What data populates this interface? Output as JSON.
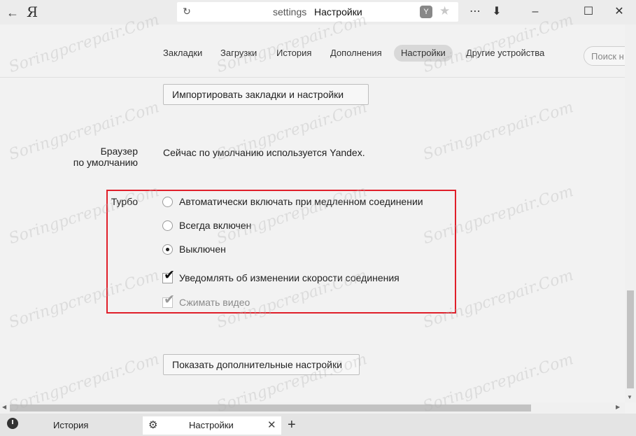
{
  "browser": {
    "logo": "Я",
    "address": {
      "host": "settings",
      "title": "Настройки"
    },
    "controls": {
      "menu": "⋯",
      "download": "⬇",
      "minimize": "–",
      "maximize": "☐",
      "close": "✕"
    }
  },
  "nav": {
    "items": [
      {
        "label": "Закладки"
      },
      {
        "label": "Загрузки"
      },
      {
        "label": "История"
      },
      {
        "label": "Дополнения"
      },
      {
        "label": "Настройки"
      },
      {
        "label": "Другие устройства"
      }
    ],
    "active": "Настройки",
    "search_placeholder": "Поиск н"
  },
  "import_button": "Импортировать закладки и настройки",
  "default_browser": {
    "label_line1": "Браузер",
    "label_line2": "по умолчанию",
    "text": "Сейчас по умолчанию используется Yandex."
  },
  "turbo": {
    "label": "Турбо",
    "options": [
      {
        "label": "Автоматически включать при медленном соединении",
        "type": "radio",
        "checked": false
      },
      {
        "label": "Всегда включен",
        "type": "radio",
        "checked": false
      },
      {
        "label": "Выключен",
        "type": "radio",
        "checked": true
      },
      {
        "label": "Уведомлять об изменении скорости соединения",
        "type": "checkbox",
        "checked": true
      },
      {
        "label": "Сжимать видео",
        "type": "checkbox",
        "checked": true,
        "disabled": true
      }
    ],
    "highlight_color": "#e01f2a"
  },
  "more_settings_button": "Показать дополнительные настройки",
  "tabs": {
    "items": [
      {
        "title": "История",
        "icon": "clock-icon"
      },
      {
        "title": "Настройки",
        "icon": "gear-icon",
        "active": true
      }
    ],
    "new_tab": "+"
  },
  "watermark_text": "Soringpcrepair.Com"
}
